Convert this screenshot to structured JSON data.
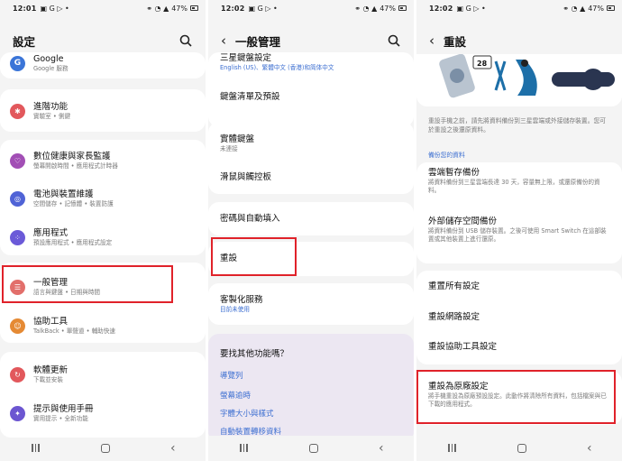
{
  "status": {
    "p1_time": "12:01",
    "p2_time": "12:02",
    "p3_time": "12:02",
    "icons_left": "▣ G ▷ •",
    "battery": "47%"
  },
  "panel1": {
    "title": "設定",
    "items": [
      {
        "title": "Google",
        "subtitle": "Google 服務",
        "color": "#3b75d8",
        "icon": "google-icon"
      },
      {
        "title": "進階功能",
        "subtitle": "實驗室 • 側鍵",
        "color": "#e2585c",
        "icon": "advanced-features-icon"
      },
      {
        "title": "數位健康與家長監護",
        "subtitle": "螢幕開啟時間 • 應用程式計時器",
        "color": "#a24fb5",
        "icon": "digital-wellbeing-icon"
      },
      {
        "title": "電池與裝置維護",
        "subtitle": "空間儲存 • 記憶體 • 裝置防護",
        "color": "#5063d6",
        "icon": "device-care-icon"
      },
      {
        "title": "應用程式",
        "subtitle": "預設應用程式 • 應用程式設定",
        "color": "#6b5ad8",
        "icon": "apps-icon"
      },
      {
        "title": "一般管理",
        "subtitle": "語言與鍵盤 • 日期與時間",
        "color": "#e26f6b",
        "icon": "general-management-icon"
      },
      {
        "title": "協助工具",
        "subtitle": "TalkBack • 單聲道 • 輔助快速",
        "color": "#e58a34",
        "icon": "accessibility-icon"
      },
      {
        "title": "軟體更新",
        "subtitle": "下載並安裝",
        "color": "#e2585c",
        "icon": "software-update-icon"
      },
      {
        "title": "提示與使用手冊",
        "subtitle": "實用提示 • 全新功能",
        "color": "#6c56d1",
        "icon": "tips-icon"
      }
    ]
  },
  "panel2": {
    "title": "一般管理",
    "top_item": {
      "title": "三星鍵盤設定",
      "subtitle": "English (US)、繁體中文 (香港)和简体中文"
    },
    "items": [
      {
        "title": "鍵盤清單及預設",
        "subtitle": ""
      },
      {
        "title": "實體鍵盤",
        "subtitle": "未連接"
      },
      {
        "title": "滑鼠與觸控板",
        "subtitle": ""
      },
      {
        "title": "密碼與自動填入",
        "subtitle": ""
      },
      {
        "title": "重設",
        "subtitle": ""
      },
      {
        "title": "客製化服務",
        "subtitle": "目前未使用"
      }
    ],
    "more": {
      "heading": "要找其他功能嗎？",
      "links": [
        "導覽列",
        "螢幕逾時",
        "字體大小與樣式",
        "自動裝置轉移資料"
      ]
    }
  },
  "panel3": {
    "title": "重設",
    "illustration_badge": "28",
    "help_text": "重設手機之前，請先將資料備份到三星雲端或外接儲存裝置。您可於重設之後還原資料。",
    "backup_label": "備份您的資料",
    "backup_items": [
      {
        "title": "雲端暫存備份",
        "subtitle": "將資料備份到三星雲端長達 30 天，容量無上限，或還原備份的資料。"
      },
      {
        "title": "外部儲存空間備份",
        "subtitle": "將資料備份到 USB 儲存裝置。之後可使用 Smart Switch 在這部裝置或其他裝置上進行還原。"
      }
    ],
    "reset_items": [
      {
        "title": "重置所有設定"
      },
      {
        "title": "重設網路設定"
      },
      {
        "title": "重設協助工具設定"
      }
    ],
    "factory_reset": {
      "title": "重設為原廠設定",
      "subtitle": "將手機重設為原廠預設設定。此動作將清除所有資料，包括檔案與已下載的應用程式。"
    }
  },
  "colors": {
    "highlight": "#e0222a",
    "link": "#3d6fd1",
    "panel_bg": "#f4f4f4"
  }
}
